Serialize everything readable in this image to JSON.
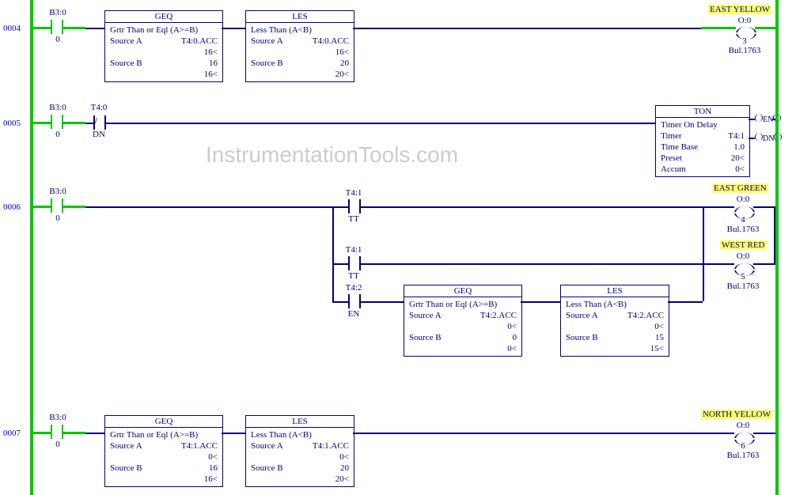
{
  "watermark": "InstrumentationTools.com",
  "rung4": {
    "num": "0004",
    "xic": {
      "addr": "B3:0",
      "bit": "0"
    },
    "geq": {
      "name": "GEQ",
      "desc": "Grtr Than or Eql (A>=B)",
      "sa_l": "Source A",
      "sa_v": "T4:0.ACC",
      "sa_n": "16<",
      "sb_l": "Source B",
      "sb_v": "16",
      "sb_n": "16<"
    },
    "les": {
      "name": "LES",
      "desc": "Less Than (A<B)",
      "sa_l": "Source A",
      "sa_v": "T4:0.ACC",
      "sa_n": "16<",
      "sb_l": "Source B",
      "sb_v": "20",
      "sb_n": "20<"
    },
    "out": {
      "title": "EAST YELLOW",
      "addr": "O:0",
      "bit": "3",
      "bul": "Bul.1763"
    }
  },
  "rung5": {
    "num": "0005",
    "xic": {
      "addr": "B3:0",
      "bit": "0"
    },
    "xio": {
      "addr": "T4:0",
      "bit": "DN"
    },
    "ton": {
      "name": "TON",
      "desc": "Timer On Delay",
      "t_l": "Timer",
      "t_v": "T4:1",
      "tb_l": "Time Base",
      "tb_v": "1.0",
      "p_l": "Preset",
      "p_v": "20<",
      "a_l": "Accum",
      "a_v": "0<",
      "en": "EN",
      "dn": "DN"
    }
  },
  "rung6": {
    "num": "0006",
    "xic": {
      "addr": "B3:0",
      "bit": "0"
    },
    "br1_xic": {
      "addr": "T4:1",
      "bit": "TT"
    },
    "out_eg": {
      "title": "EAST GREEN",
      "addr": "O:0",
      "bit": "4",
      "bul": "Bul.1763"
    },
    "br2_xic": {
      "addr": "T4:1",
      "bit": "TT"
    },
    "out_wr": {
      "title": "WEST RED",
      "addr": "O:0",
      "bit": "5",
      "bul": "Bul.1763"
    },
    "br3_xic": {
      "addr": "T4:2",
      "bit": "EN"
    },
    "geq": {
      "name": "GEQ",
      "desc": "Grtr Than or Eql (A>=B)",
      "sa_l": "Source A",
      "sa_v": "T4:2.ACC",
      "sa_n": "0<",
      "sb_l": "Source B",
      "sb_v": "0",
      "sb_n": "0<"
    },
    "les": {
      "name": "LES",
      "desc": "Less Than (A<B)",
      "sa_l": "Source A",
      "sa_v": "T4:2.ACC",
      "sa_n": "0<",
      "sb_l": "Source B",
      "sb_v": "15",
      "sb_n": "15<"
    }
  },
  "rung7": {
    "num": "0007",
    "xic": {
      "addr": "B3:0",
      "bit": "0"
    },
    "geq": {
      "name": "GEQ",
      "desc": "Grtr Than or Eql (A>=B)",
      "sa_l": "Source A",
      "sa_v": "T4:1.ACC",
      "sa_n": "0<",
      "sb_l": "Source B",
      "sb_v": "16",
      "sb_n": "16<"
    },
    "les": {
      "name": "LES",
      "desc": "Less Than (A<B)",
      "sa_l": "Source A",
      "sa_v": "T4:1.ACC",
      "sa_n": "0<",
      "sb_l": "Source B",
      "sb_v": "20",
      "sb_n": "20<"
    },
    "out": {
      "title": "NORTH YELLOW",
      "addr": "O:0",
      "bit": "6",
      "bul": "Bul.1763"
    }
  }
}
